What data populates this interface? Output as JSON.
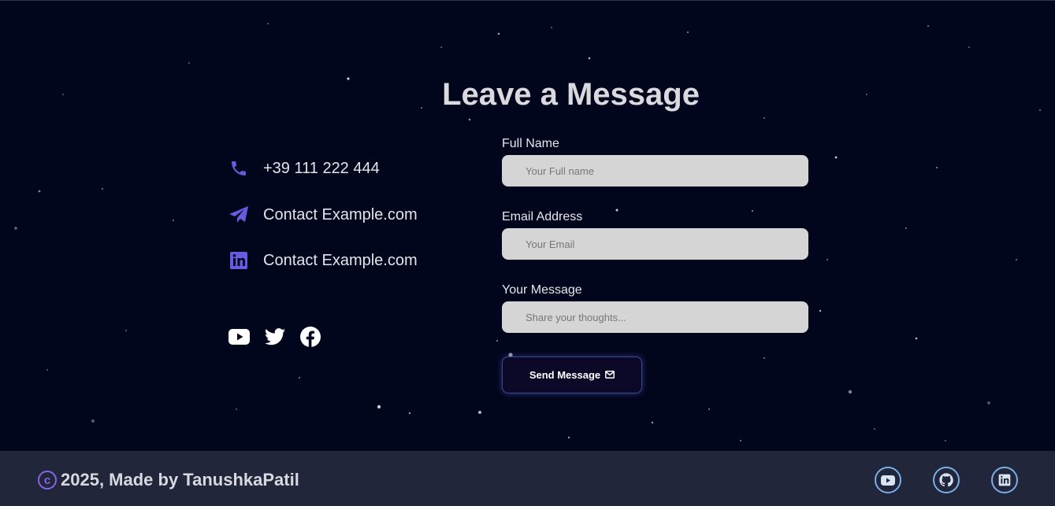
{
  "page": {
    "title": "Leave a Message"
  },
  "contact": {
    "items": [
      {
        "icon": "phone-icon",
        "text": "+39 111 222 444"
      },
      {
        "icon": "paper-plane-icon",
        "text": "Contact Example.com"
      },
      {
        "icon": "linkedin-icon",
        "text": "Contact Example.com"
      }
    ],
    "socials": [
      "youtube-icon",
      "twitter-icon",
      "facebook-icon"
    ]
  },
  "form": {
    "name_label": "Full Name",
    "name_placeholder": "Your Full name",
    "email_label": "Email Address",
    "email_placeholder": "Your Email",
    "message_label": "Your Message",
    "message_placeholder": "Share your thoughts...",
    "submit_label": "Send Message",
    "submit_icon": "envelope-icon"
  },
  "footer": {
    "text": "2025, Made by TanushkaPatil",
    "copyright_icon": "copyright-icon",
    "socials": [
      "youtube-icon",
      "github-icon",
      "linkedin-icon"
    ]
  },
  "colors": {
    "background": "#02061c",
    "accent": "#6a5ae0",
    "footer_bg": "#22263a",
    "footer_icon_ring": "#7aaee8",
    "input_bg": "#d5d5d5"
  }
}
